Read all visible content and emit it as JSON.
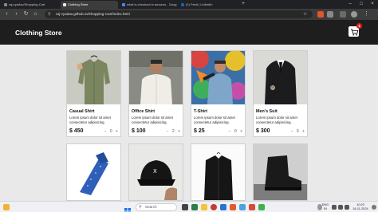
{
  "browser": {
    "tabs": [
      {
        "label": "raj-vyadav/Shopping-Cart",
        "favicon_color": "#444444"
      },
      {
        "label": "Clothing Store",
        "favicon_color": "#e8e8e8"
      },
      {
        "label": "what is checkout in amazon - Goog",
        "favicon_color": "#4285f4"
      },
      {
        "label": "(1) Feed | LinkedIn",
        "favicon_color": "#0a66c2"
      }
    ],
    "new_tab": "+",
    "url": "raj-vyadav.github.io/Shopping-Cart/index.html",
    "back": "‹",
    "forward": "›",
    "reload": "↻"
  },
  "header": {
    "brand": "Clothing Store",
    "cart_count": "1"
  },
  "products": [
    {
      "name": "Casual Shirt",
      "desc": "Lorem ipsum dolor sit amet consectetur adipisicing.",
      "price": "$ 450",
      "qty": "0",
      "minus": "−",
      "plus": "+",
      "image": "shirt-green"
    },
    {
      "name": "Office Shirt",
      "desc": "Lorem ipsum dolor sit amet consectetur adipisicing.",
      "price": "$ 100",
      "qty": "2",
      "minus": "−",
      "plus": "+",
      "image": "shirt-white"
    },
    {
      "name": "T-Shirt",
      "desc": "Lorem ipsum dolor sit amet consectetur adipisicing.",
      "price": "$ 25",
      "qty": "0",
      "minus": "−",
      "plus": "+",
      "image": "tshirt-graffiti"
    },
    {
      "name": "Men's Suit",
      "desc": "Lorem ipsum dolor sit amet consectetur adipisicing.",
      "price": "$ 300",
      "qty": "0",
      "minus": "−",
      "plus": "+",
      "image": "suit-black"
    }
  ],
  "products_row2": [
    {
      "image": "tie-blue"
    },
    {
      "image": "cap-black"
    },
    {
      "image": "jacket-black"
    },
    {
      "image": "boot-black"
    }
  ],
  "taskbar": {
    "search": "Search",
    "lang": "ENG",
    "region": "IN",
    "time": "10:23",
    "date": "16-11-2024"
  }
}
